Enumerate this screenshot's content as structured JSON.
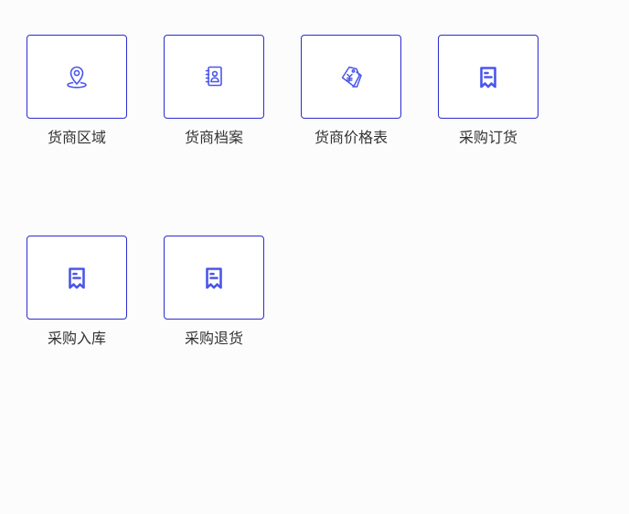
{
  "colors": {
    "tile_border": "#2c2ccf",
    "icon": "#4b56ea",
    "label": "#333333"
  },
  "tiles": [
    {
      "label": "货商区域",
      "icon": "location-pin-icon"
    },
    {
      "label": "货商档案",
      "icon": "contact-book-icon"
    },
    {
      "label": "货商价格表",
      "icon": "price-tag-icon"
    },
    {
      "label": "采购订货",
      "icon": "receipt-icon"
    },
    {
      "label": "采购入库",
      "icon": "receipt-icon"
    },
    {
      "label": "采购退货",
      "icon": "receipt-icon"
    }
  ]
}
